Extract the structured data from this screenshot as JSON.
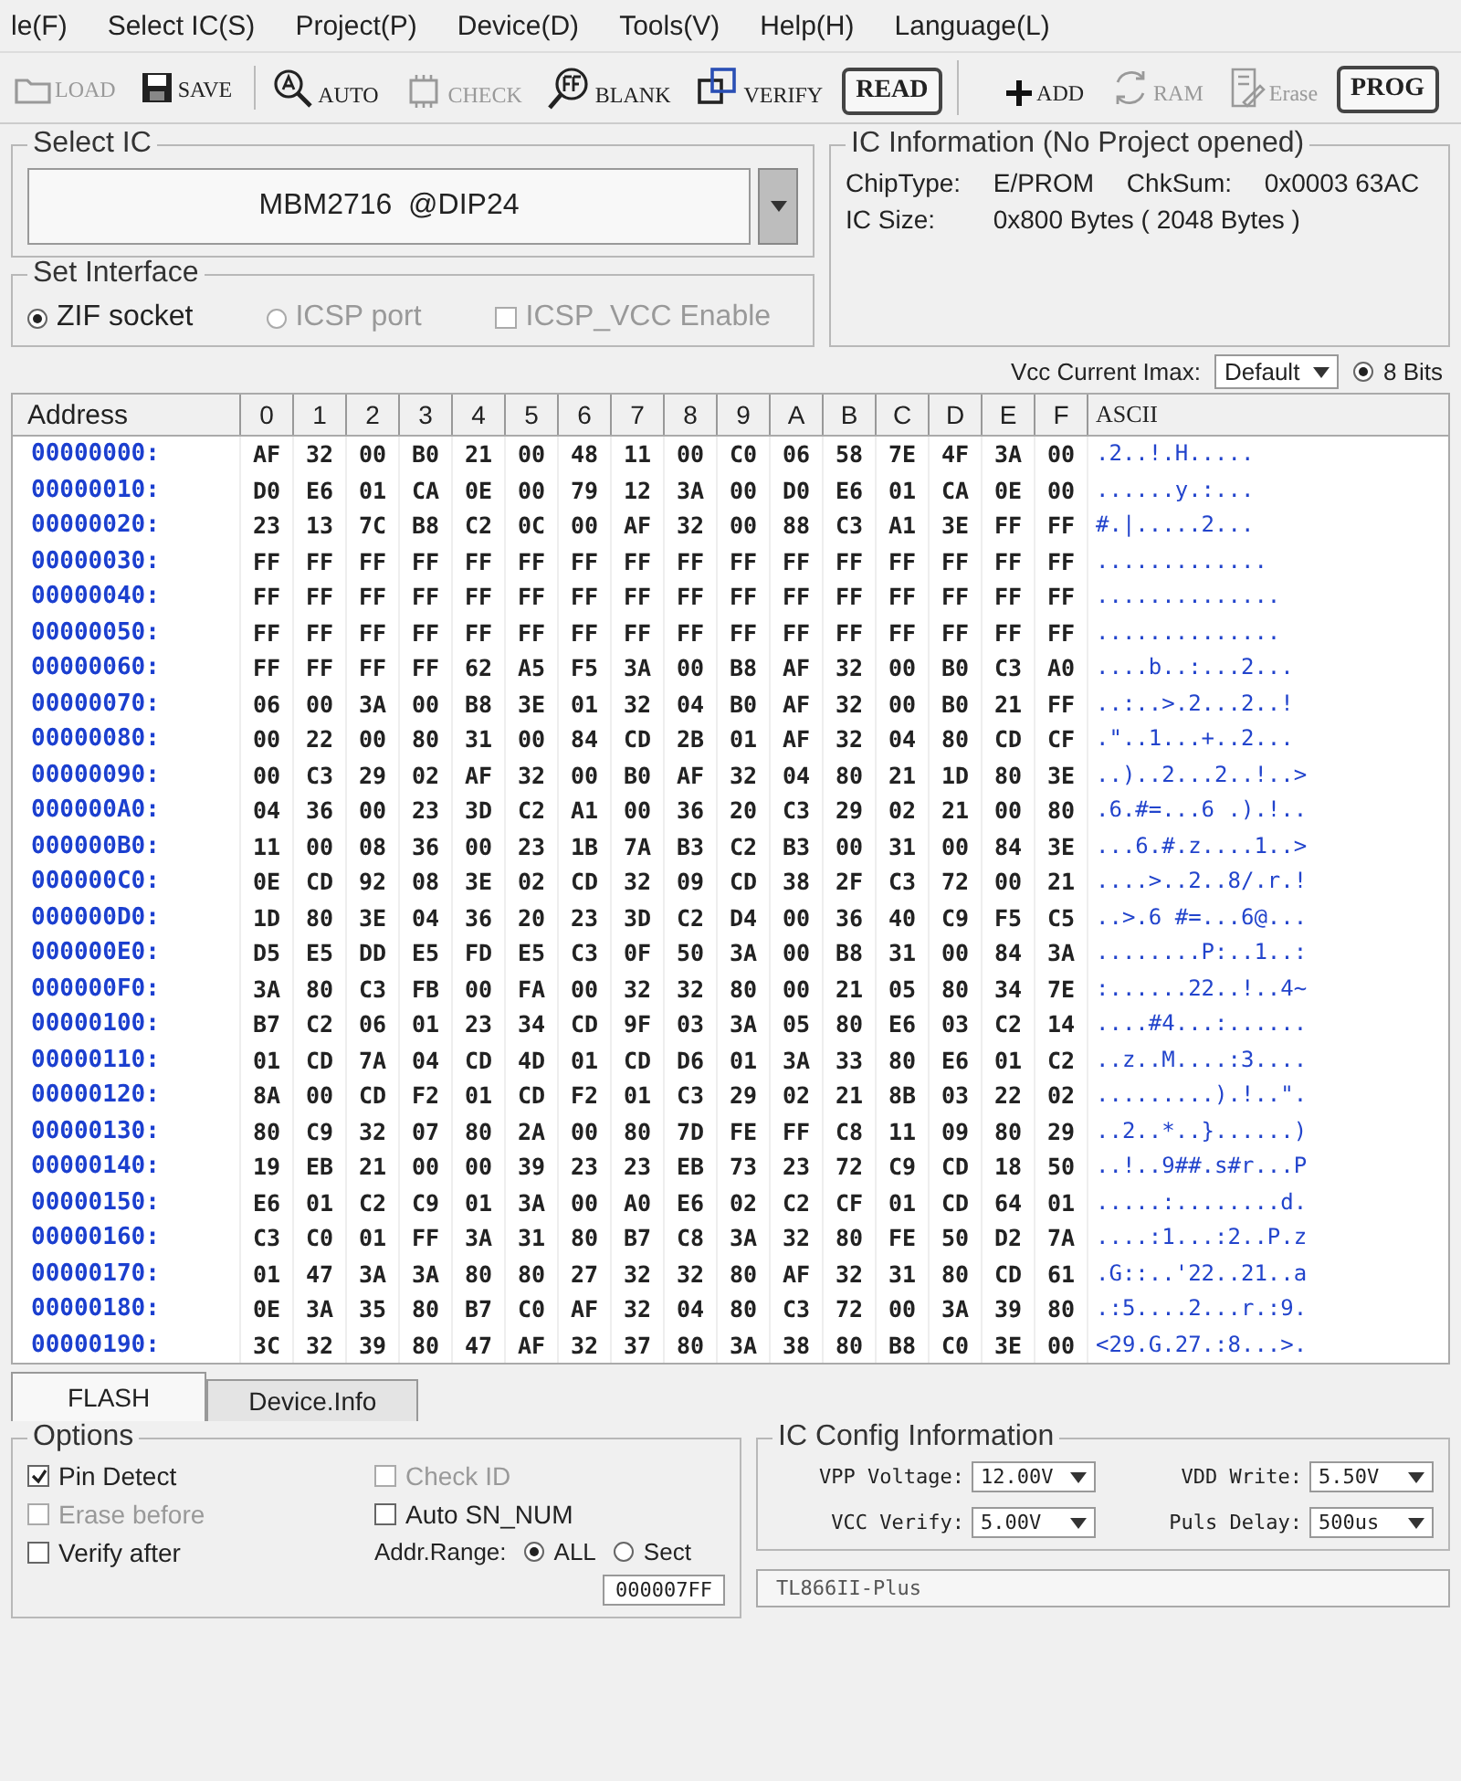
{
  "menu": [
    "le(F)",
    "Select IC(S)",
    "Project(P)",
    "Device(D)",
    "Tools(V)",
    "Help(H)",
    "Language(L)"
  ],
  "toolbar_groups": [
    {
      "buttons": [
        {
          "label": "LOAD",
          "kind": "load",
          "disabled": true
        },
        {
          "label": "SAVE",
          "kind": "save",
          "disabled": false
        }
      ]
    },
    {
      "buttons": [
        {
          "label": "AUTO",
          "kind": "auto",
          "disabled": false
        },
        {
          "label": "CHECK",
          "kind": "check",
          "disabled": true
        },
        {
          "label": "BLANK",
          "kind": "blank",
          "disabled": false
        },
        {
          "label": "VERIFY",
          "kind": "verify",
          "disabled": false
        },
        {
          "label": "READ",
          "kind": "framed",
          "disabled": false
        }
      ]
    },
    {
      "buttons": [
        {
          "label": "ADD",
          "kind": "add",
          "disabled": false
        },
        {
          "label": "RAM",
          "kind": "ram",
          "disabled": true
        },
        {
          "label": "Erase",
          "kind": "erase",
          "disabled": true
        },
        {
          "label": "PROG",
          "kind": "framed",
          "disabled": false
        }
      ]
    }
  ],
  "select_ic": {
    "title": "Select IC",
    "chip": "MBM2716  @DIP24"
  },
  "interface": {
    "title": "Set Interface",
    "options": [
      {
        "label": "ZIF socket",
        "selected": true,
        "disabled": false
      },
      {
        "label": "ICSP port",
        "selected": false,
        "disabled": true
      }
    ],
    "icsp_vcc": {
      "label": "ICSP_VCC Enable",
      "checked": false,
      "disabled": true
    }
  },
  "ic_info": {
    "title": "IC Information (No Project opened)",
    "chip_type": {
      "label": "ChipType:",
      "value": "E/PROM"
    },
    "checksum": {
      "label": "ChkSum:",
      "value": "0x0003 63AC"
    },
    "ic_size": {
      "label": "IC Size:",
      "value": "0x800 Bytes ( 2048 Bytes )"
    }
  },
  "vcc_current": {
    "label": "Vcc Current Imax:",
    "value": "Default"
  },
  "bits": {
    "label": "8 Bits",
    "selected": true
  },
  "hex": {
    "address_header": "Address",
    "columns": [
      "0",
      "1",
      "2",
      "3",
      "4",
      "5",
      "6",
      "7",
      "8",
      "9",
      "A",
      "B",
      "C",
      "D",
      "E",
      "F"
    ],
    "ascii_header": "ASCII",
    "rows": [
      {
        "address": "00000000:",
        "bytes": [
          "AF",
          "32",
          "00",
          "B0",
          "21",
          "00",
          "48",
          "11",
          "00",
          "C0",
          "06",
          "58",
          "7E",
          "4F",
          "3A",
          "00"
        ],
        "ascii": ".2..!.H....."
      },
      {
        "address": "00000010:",
        "bytes": [
          "D0",
          "E6",
          "01",
          "CA",
          "0E",
          "00",
          "79",
          "12",
          "3A",
          "00",
          "D0",
          "E6",
          "01",
          "CA",
          "0E",
          "00"
        ],
        "ascii": "......y.:..."
      },
      {
        "address": "00000020:",
        "bytes": [
          "23",
          "13",
          "7C",
          "B8",
          "C2",
          "0C",
          "00",
          "AF",
          "32",
          "00",
          "88",
          "C3",
          "A1",
          "3E",
          "FF",
          "FF"
        ],
        "ascii": "#.|.....2..."
      },
      {
        "address": "00000030:",
        "bytes": [
          "FF",
          "FF",
          "FF",
          "FF",
          "FF",
          "FF",
          "FF",
          "FF",
          "FF",
          "FF",
          "FF",
          "FF",
          "FF",
          "FF",
          "FF",
          "FF"
        ],
        "ascii": "............."
      },
      {
        "address": "00000040:",
        "bytes": [
          "FF",
          "FF",
          "FF",
          "FF",
          "FF",
          "FF",
          "FF",
          "FF",
          "FF",
          "FF",
          "FF",
          "FF",
          "FF",
          "FF",
          "FF",
          "FF"
        ],
        "ascii": ".............."
      },
      {
        "address": "00000050:",
        "bytes": [
          "FF",
          "FF",
          "FF",
          "FF",
          "FF",
          "FF",
          "FF",
          "FF",
          "FF",
          "FF",
          "FF",
          "FF",
          "FF",
          "FF",
          "FF",
          "FF"
        ],
        "ascii": ".............."
      },
      {
        "address": "00000060:",
        "bytes": [
          "FF",
          "FF",
          "FF",
          "FF",
          "62",
          "A5",
          "F5",
          "3A",
          "00",
          "B8",
          "AF",
          "32",
          "00",
          "B0",
          "C3",
          "A0"
        ],
        "ascii": "....b..:...2..."
      },
      {
        "address": "00000070:",
        "bytes": [
          "06",
          "00",
          "3A",
          "00",
          "B8",
          "3E",
          "01",
          "32",
          "04",
          "B0",
          "AF",
          "32",
          "00",
          "B0",
          "21",
          "FF"
        ],
        "ascii": "..:..>.2...2..!"
      },
      {
        "address": "00000080:",
        "bytes": [
          "00",
          "22",
          "00",
          "80",
          "31",
          "00",
          "84",
          "CD",
          "2B",
          "01",
          "AF",
          "32",
          "04",
          "80",
          "CD",
          "CF"
        ],
        "ascii": ".\"..1...+..2..."
      },
      {
        "address": "00000090:",
        "bytes": [
          "00",
          "C3",
          "29",
          "02",
          "AF",
          "32",
          "00",
          "B0",
          "AF",
          "32",
          "04",
          "80",
          "21",
          "1D",
          "80",
          "3E"
        ],
        "ascii": "..)..2...2..!..>"
      },
      {
        "address": "000000A0:",
        "bytes": [
          "04",
          "36",
          "00",
          "23",
          "3D",
          "C2",
          "A1",
          "00",
          "36",
          "20",
          "C3",
          "29",
          "02",
          "21",
          "00",
          "80"
        ],
        "ascii": ".6.#=...6 .).!.."
      },
      {
        "address": "000000B0:",
        "bytes": [
          "11",
          "00",
          "08",
          "36",
          "00",
          "23",
          "1B",
          "7A",
          "B3",
          "C2",
          "B3",
          "00",
          "31",
          "00",
          "84",
          "3E"
        ],
        "ascii": "...6.#.z....1..>"
      },
      {
        "address": "000000C0:",
        "bytes": [
          "0E",
          "CD",
          "92",
          "08",
          "3E",
          "02",
          "CD",
          "32",
          "09",
          "CD",
          "38",
          "2F",
          "C3",
          "72",
          "00",
          "21"
        ],
        "ascii": "....>..2..8/.r.!"
      },
      {
        "address": "000000D0:",
        "bytes": [
          "1D",
          "80",
          "3E",
          "04",
          "36",
          "20",
          "23",
          "3D",
          "C2",
          "D4",
          "00",
          "36",
          "40",
          "C9",
          "F5",
          "C5"
        ],
        "ascii": "..>.6 #=...6@..."
      },
      {
        "address": "000000E0:",
        "bytes": [
          "D5",
          "E5",
          "DD",
          "E5",
          "FD",
          "E5",
          "C3",
          "0F",
          "50",
          "3A",
          "00",
          "B8",
          "31",
          "00",
          "84",
          "3A"
        ],
        "ascii": "........P:..1..:"
      },
      {
        "address": "000000F0:",
        "bytes": [
          "3A",
          "80",
          "C3",
          "FB",
          "00",
          "FA",
          "00",
          "32",
          "32",
          "80",
          "00",
          "21",
          "05",
          "80",
          "34",
          "7E"
        ],
        "ascii": ":......22..!..4~"
      },
      {
        "address": "00000100:",
        "bytes": [
          "B7",
          "C2",
          "06",
          "01",
          "23",
          "34",
          "CD",
          "9F",
          "03",
          "3A",
          "05",
          "80",
          "E6",
          "03",
          "C2",
          "14"
        ],
        "ascii": "....#4...:......"
      },
      {
        "address": "00000110:",
        "bytes": [
          "01",
          "CD",
          "7A",
          "04",
          "CD",
          "4D",
          "01",
          "CD",
          "D6",
          "01",
          "3A",
          "33",
          "80",
          "E6",
          "01",
          "C2"
        ],
        "ascii": "..z..M....:3...."
      },
      {
        "address": "00000120:",
        "bytes": [
          "8A",
          "00",
          "CD",
          "F2",
          "01",
          "CD",
          "F2",
          "01",
          "C3",
          "29",
          "02",
          "21",
          "8B",
          "03",
          "22",
          "02"
        ],
        "ascii": ".........).!..\"."
      },
      {
        "address": "00000130:",
        "bytes": [
          "80",
          "C9",
          "32",
          "07",
          "80",
          "2A",
          "00",
          "80",
          "7D",
          "FE",
          "FF",
          "C8",
          "11",
          "09",
          "80",
          "29"
        ],
        "ascii": "..2..*..}......)"
      },
      {
        "address": "00000140:",
        "bytes": [
          "19",
          "EB",
          "21",
          "00",
          "00",
          "39",
          "23",
          "23",
          "EB",
          "73",
          "23",
          "72",
          "C9",
          "CD",
          "18",
          "50"
        ],
        "ascii": "..!..9##.s#r...P"
      },
      {
        "address": "00000150:",
        "bytes": [
          "E6",
          "01",
          "C2",
          "C9",
          "01",
          "3A",
          "00",
          "A0",
          "E6",
          "02",
          "C2",
          "CF",
          "01",
          "CD",
          "64",
          "01"
        ],
        "ascii": ".....:........d."
      },
      {
        "address": "00000160:",
        "bytes": [
          "C3",
          "C0",
          "01",
          "FF",
          "3A",
          "31",
          "80",
          "B7",
          "C8",
          "3A",
          "32",
          "80",
          "FE",
          "50",
          "D2",
          "7A"
        ],
        "ascii": "....:1...:2..P.z"
      },
      {
        "address": "00000170:",
        "bytes": [
          "01",
          "47",
          "3A",
          "3A",
          "80",
          "80",
          "27",
          "32",
          "32",
          "80",
          "AF",
          "32",
          "31",
          "80",
          "CD",
          "61"
        ],
        "ascii": ".G::..'22..21..a"
      },
      {
        "address": "00000180:",
        "bytes": [
          "0E",
          "3A",
          "35",
          "80",
          "B7",
          "C0",
          "AF",
          "32",
          "04",
          "80",
          "C3",
          "72",
          "00",
          "3A",
          "39",
          "80"
        ],
        "ascii": ".:5....2...r.:9."
      },
      {
        "address": "00000190:",
        "bytes": [
          "3C",
          "32",
          "39",
          "80",
          "47",
          "AF",
          "32",
          "37",
          "80",
          "3A",
          "38",
          "80",
          "B8",
          "C0",
          "3E",
          "00"
        ],
        "ascii": "<29.G.27.:8...>."
      }
    ]
  },
  "tabs": [
    {
      "label": "FLASH",
      "selected": true
    },
    {
      "label": "Device.Info",
      "selected": false
    }
  ],
  "options": {
    "title": "Options",
    "checks_left": [
      {
        "label": "Pin Detect",
        "checked": true,
        "disabled": false
      },
      {
        "label": "Erase before",
        "checked": false,
        "disabled": true
      },
      {
        "label": "Verify after",
        "checked": false,
        "disabled": false
      }
    ],
    "checks_right": [
      {
        "label": "Check ID",
        "checked": false,
        "disabled": true
      },
      {
        "label": "Auto SN_NUM",
        "checked": false,
        "disabled": false
      }
    ],
    "addr_range": {
      "label": "Addr.Range:",
      "options": [
        {
          "label": "ALL",
          "selected": true
        },
        {
          "label": "Sect",
          "selected": false
        }
      ]
    },
    "end_address": "000007FF"
  },
  "ic_config": {
    "title": "IC Config Information",
    "left": [
      {
        "label": "VPP Voltage:",
        "value": "12.00V"
      },
      {
        "label": "VCC Verify:",
        "value": "5.00V"
      }
    ],
    "right": [
      {
        "label": "VDD Write:",
        "value": "5.50V"
      },
      {
        "label": "Puls Delay:",
        "value": "500us"
      }
    ]
  },
  "status": "TL866II-Plus"
}
